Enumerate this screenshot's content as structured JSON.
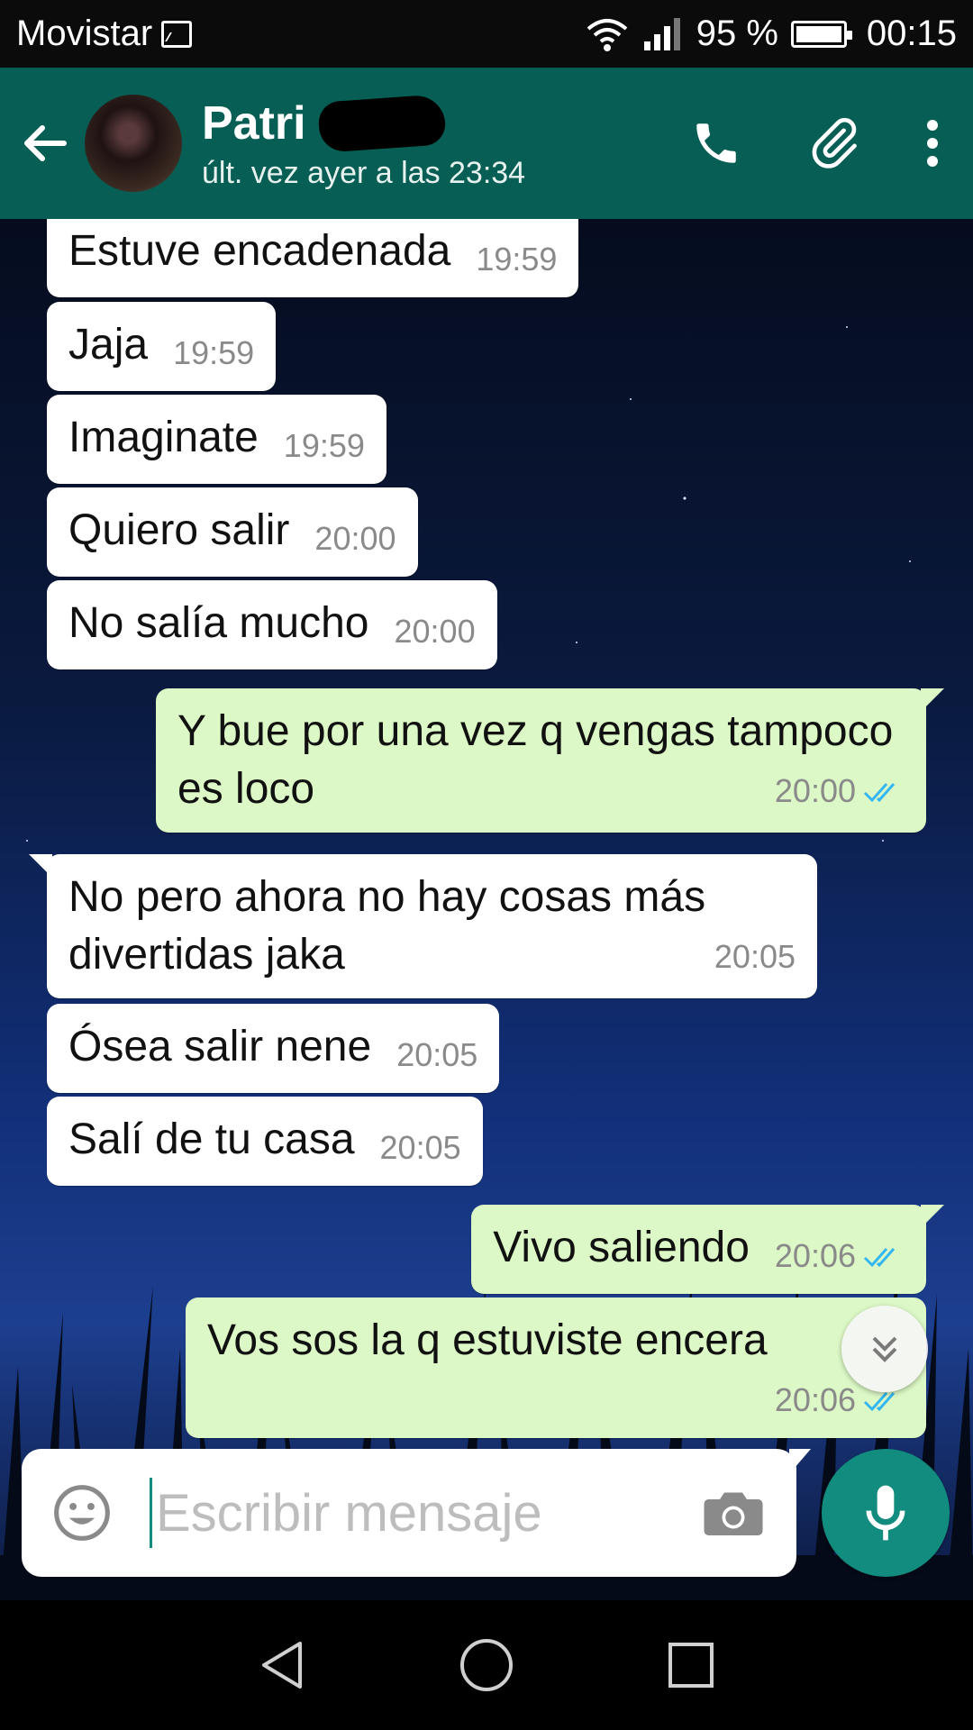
{
  "status_bar": {
    "carrier": "Movistar",
    "battery": "95 %",
    "time": "00:15",
    "icons": [
      "image-icon",
      "wifi-icon",
      "signal-icon",
      "battery-icon"
    ]
  },
  "header": {
    "contact_name": "Patri",
    "last_seen": "últ. vez ayer a las 23:34",
    "icons": [
      "back-arrow-icon",
      "phone-icon",
      "paperclip-icon",
      "more-vert-icon"
    ],
    "accent_color": "#075e54"
  },
  "messages": [
    {
      "dir": "in",
      "text": "Estuve encadenada",
      "time": "19:59"
    },
    {
      "dir": "in",
      "text": "Jaja",
      "time": "19:59"
    },
    {
      "dir": "in",
      "text": "Imaginate",
      "time": "19:59"
    },
    {
      "dir": "in",
      "text": "Quiero salir",
      "time": "20:00"
    },
    {
      "dir": "in",
      "text": "No salía mucho",
      "time": "20:00"
    },
    {
      "dir": "out",
      "text": "Y bue por una vez q vengas tampoco es loco",
      "time": "20:00"
    },
    {
      "dir": "in",
      "text": "No pero ahora no hay cosas más divertidas jaka",
      "time": "20:05"
    },
    {
      "dir": "in",
      "text": "Ósea salir nene",
      "time": "20:05"
    },
    {
      "dir": "in",
      "text": "Salí de tu casa",
      "time": "20:05"
    },
    {
      "dir": "out",
      "text": "Vivo saliendo",
      "time": "20:06"
    },
    {
      "dir": "out",
      "text": "Vos sos la q estuviste encera",
      "time": "20:06"
    }
  ],
  "composer": {
    "placeholder": "Escribir mensaje",
    "icons": [
      "emoji-icon",
      "camera-icon",
      "mic-icon"
    ]
  },
  "colors": {
    "incoming_bubble": "#ffffff",
    "outgoing_bubble": "#dcf8c6",
    "read_ticks": "#34b7f1",
    "mic_button": "#128c7e"
  }
}
